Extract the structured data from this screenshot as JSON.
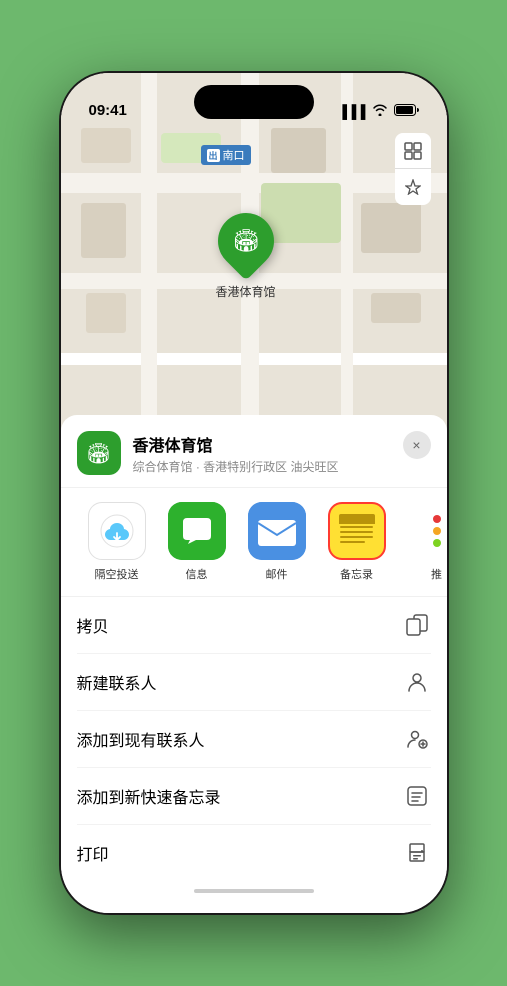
{
  "status_bar": {
    "time": "09:41",
    "signal": "●●●",
    "wifi": "WiFi",
    "battery": "Batt"
  },
  "map": {
    "label": "南口",
    "btn_map": "🗺",
    "btn_location": "➤",
    "pin_label": "香港体育馆"
  },
  "sheet": {
    "title": "香港体育馆",
    "subtitle": "综合体育馆 · 香港特别行政区 油尖旺区",
    "close_label": "×"
  },
  "share_items": [
    {
      "label": "隔空投送",
      "type": "airdrop"
    },
    {
      "label": "信息",
      "type": "messages"
    },
    {
      "label": "邮件",
      "type": "mail"
    },
    {
      "label": "备忘录",
      "type": "notes"
    },
    {
      "label": "推",
      "type": "more"
    }
  ],
  "actions": [
    {
      "label": "拷贝",
      "icon": "copy"
    },
    {
      "label": "新建联系人",
      "icon": "person"
    },
    {
      "label": "添加到现有联系人",
      "icon": "person-add"
    },
    {
      "label": "添加到新快速备忘录",
      "icon": "note"
    },
    {
      "label": "打印",
      "icon": "print"
    }
  ]
}
